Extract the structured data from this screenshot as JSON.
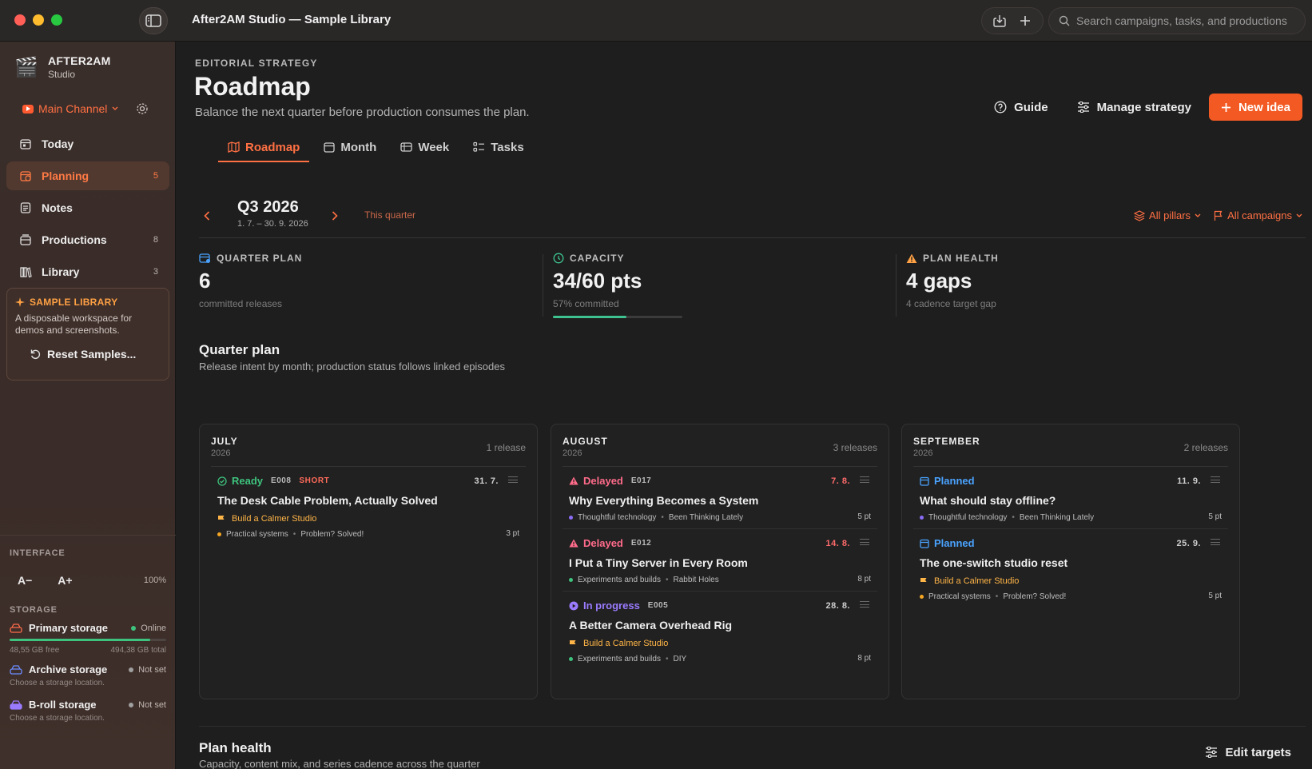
{
  "window": {
    "title": "After2AM Studio — Sample Library",
    "search_placeholder": "Search campaigns, tasks, and productions"
  },
  "sidebar": {
    "workspace_name": "AFTER2AM",
    "workspace_sub": "Studio",
    "channel": "Main Channel",
    "items": [
      {
        "label": "Today",
        "count": ""
      },
      {
        "label": "Planning",
        "count": "5"
      },
      {
        "label": "Notes",
        "count": ""
      },
      {
        "label": "Productions",
        "count": "8"
      },
      {
        "label": "Library",
        "count": "3"
      }
    ],
    "sample": {
      "title": "SAMPLE LIBRARY",
      "desc": "A disposable workspace for demos and screenshots.",
      "reset": "Reset Samples..."
    },
    "interface_label": "INTERFACE",
    "font_smaller": "A−",
    "font_larger": "A+",
    "zoom": "100%",
    "storage_label": "STORAGE",
    "storage": [
      {
        "name": "Primary storage",
        "status": "Online",
        "status_color": "#3ec37e",
        "free": "48,55 GB free",
        "total": "494,38 GB total",
        "used_fraction": 0.9
      },
      {
        "name": "Archive storage",
        "status": "Not set",
        "status_color": "#a0a0a0",
        "hint": "Choose a storage location."
      },
      {
        "name": "B-roll storage",
        "status": "Not set",
        "status_color": "#a0a0a0",
        "hint": "Choose a storage location."
      }
    ]
  },
  "header": {
    "eyebrow": "EDITORIAL STRATEGY",
    "title": "Roadmap",
    "subtitle": "Balance the next quarter before production consumes the plan.",
    "guide": "Guide",
    "manage": "Manage strategy",
    "new_idea": "New idea",
    "tabs": [
      "Roadmap",
      "Month",
      "Week",
      "Tasks"
    ]
  },
  "period": {
    "name": "Q3 2026",
    "range": "1. 7. – 30. 9. 2026",
    "this_quarter": "This quarter",
    "filter_pillars": "All pillars",
    "filter_campaigns": "All campaigns"
  },
  "stats": {
    "plan": {
      "label": "QUARTER PLAN",
      "value": "6",
      "sub": "committed releases"
    },
    "capacity": {
      "label": "CAPACITY",
      "value": "34/60 pts",
      "sub": "57% committed",
      "fraction": 0.57
    },
    "health": {
      "label": "PLAN HEALTH",
      "value": "4 gaps",
      "sub": "4 cadence target gap"
    }
  },
  "quarter_plan": {
    "title": "Quarter plan",
    "subtitle": "Release intent by month; production status follows linked episodes",
    "months": [
      {
        "name": "JULY",
        "year": "2026",
        "count": "1 release",
        "releases": [
          {
            "status": "Ready",
            "status_color": "#3ec37e",
            "icon": "check-circle-icon",
            "code": "E008",
            "tag": "SHORT",
            "date": "31. 7.",
            "late": false,
            "title": "The Desk Cable Problem, Actually Solved",
            "campaign": "Build a Calmer Studio",
            "pillar": "Practical systems",
            "pillar_color": "#f5a623",
            "series": "Problem? Solved!",
            "points": "3 pt"
          }
        ]
      },
      {
        "name": "AUGUST",
        "year": "2026",
        "count": "3 releases",
        "releases": [
          {
            "status": "Delayed",
            "status_color": "#ff6b8a",
            "icon": "warning-icon",
            "code": "E017",
            "tag": "",
            "date": "7. 8.",
            "late": true,
            "title": "Why Everything Becomes a System",
            "campaign": "",
            "pillar": "Thoughtful technology",
            "pillar_color": "#8b6cf6",
            "series": "Been Thinking Lately",
            "points": "5 pt"
          },
          {
            "status": "Delayed",
            "status_color": "#ff6b8a",
            "icon": "warning-icon",
            "code": "E012",
            "tag": "",
            "date": "14. 8.",
            "late": true,
            "title": "I Put a Tiny Server in Every Room",
            "campaign": "",
            "pillar": "Experiments and builds",
            "pillar_color": "#3ec37e",
            "series": "Rabbit Holes",
            "points": "8 pt"
          },
          {
            "status": "In progress",
            "status_color": "#9b7bff",
            "icon": "play-circle-icon",
            "code": "E005",
            "tag": "",
            "date": "28. 8.",
            "late": false,
            "title": "A Better Camera Overhead Rig",
            "campaign": "Build a Calmer Studio",
            "pillar": "Experiments and builds",
            "pillar_color": "#3ec37e",
            "series": "DIY",
            "points": "8 pt"
          }
        ]
      },
      {
        "name": "SEPTEMBER",
        "year": "2026",
        "count": "2 releases",
        "releases": [
          {
            "status": "Planned",
            "status_color": "#4aa3ff",
            "icon": "calendar-icon",
            "code": "",
            "tag": "",
            "date": "11. 9.",
            "late": false,
            "title": "What should stay offline?",
            "campaign": "",
            "pillar": "Thoughtful technology",
            "pillar_color": "#8b6cf6",
            "series": "Been Thinking Lately",
            "points": "5 pt"
          },
          {
            "status": "Planned",
            "status_color": "#4aa3ff",
            "icon": "calendar-icon",
            "code": "",
            "tag": "",
            "date": "25. 9.",
            "late": false,
            "title": "The one-switch studio reset",
            "campaign": "Build a Calmer Studio",
            "pillar": "Practical systems",
            "pillar_color": "#f5a623",
            "series": "Problem? Solved!",
            "points": "5 pt"
          }
        ]
      }
    ]
  },
  "plan_health": {
    "title": "Plan health",
    "subtitle": "Capacity, content mix, and series cadence across the quarter",
    "edit_targets": "Edit targets"
  }
}
